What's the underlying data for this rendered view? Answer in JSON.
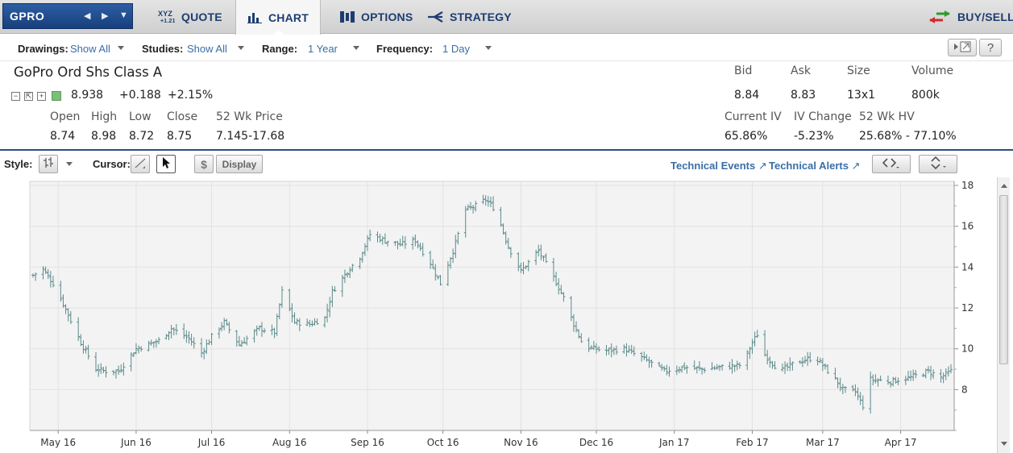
{
  "nav": {
    "symbol": "GPRO",
    "tabs": [
      {
        "label": "QUOTE",
        "icon": "xyz-quote-icon"
      },
      {
        "label": "CHART",
        "icon": "bar-chart-icon"
      },
      {
        "label": "OPTIONS",
        "icon": "options-icon"
      },
      {
        "label": "STRATEGY",
        "icon": "strategy-icon"
      }
    ],
    "buy_sell": "BUY/SELL"
  },
  "drawbar": {
    "drawings_label": "Drawings:",
    "drawings_value": "Show All",
    "studies_label": "Studies:",
    "studies_value": "Show All",
    "range_label": "Range:",
    "range_value": "1 Year",
    "frequency_label": "Frequency:",
    "frequency_value": "1 Day",
    "help_label": "?"
  },
  "quote": {
    "name": "GoPro Ord Shs Class A",
    "last": "8.938",
    "change": "+0.188",
    "change_pct": "+2.15%",
    "open_label": "Open",
    "open": "8.74",
    "high_label": "High",
    "high": "8.98",
    "low_label": "Low",
    "low": "8.72",
    "close_label": "Close",
    "close": "8.75",
    "wk52_label": "52 Wk Price",
    "wk52": "7.145-17.68",
    "bid_label": "Bid",
    "bid": "8.84",
    "ask_label": "Ask",
    "ask": "8.83",
    "size_label": "Size",
    "size": "13x1",
    "volume_label": "Volume",
    "volume": "800k",
    "iv_label": "Current IV",
    "iv": "65.86%",
    "ivchg_label": "IV Change",
    "ivchg": "-5.23%",
    "hv_label": "52 Wk HV",
    "hv": "25.68% - 77.10%",
    "positive_color": "#7bbf7b"
  },
  "stylebar": {
    "style_label": "Style:",
    "cursor_label": "Cursor:",
    "dollar_label": "$",
    "display_label": "Display",
    "tech_events": "Technical Events",
    "tech_alerts": "Technical Alerts"
  },
  "chart_data": {
    "type": "ohlc",
    "color": "#5b8a8a",
    "ylim": [
      6,
      18.2
    ],
    "yticks": [
      8,
      10,
      12,
      14,
      16,
      18
    ],
    "xtick_labels": [
      "May 16",
      "Jun 16",
      "Jul 16",
      "Aug 16",
      "Sep 16",
      "Oct 16",
      "Nov 16",
      "Dec 16",
      "Jan 17",
      "Feb 17",
      "Mar 17",
      "Apr 17"
    ],
    "x_start": "2016-04-21",
    "x_end": "2017-04-21",
    "anchors": [
      [
        "2016-04-21",
        13.6
      ],
      [
        "2016-04-25",
        13.9
      ],
      [
        "2016-04-29",
        13.2
      ],
      [
        "2016-05-03",
        12.2
      ],
      [
        "2016-05-10",
        10.3
      ],
      [
        "2016-05-16",
        9.0
      ],
      [
        "2016-05-20",
        8.9
      ],
      [
        "2016-05-25",
        8.9
      ],
      [
        "2016-06-01",
        10.0
      ],
      [
        "2016-06-10",
        10.4
      ],
      [
        "2016-06-15",
        11.0
      ],
      [
        "2016-06-22",
        10.5
      ],
      [
        "2016-06-27",
        9.8
      ],
      [
        "2016-07-01",
        10.6
      ],
      [
        "2016-07-06",
        11.3
      ],
      [
        "2016-07-12",
        10.2
      ],
      [
        "2016-07-20",
        11.0
      ],
      [
        "2016-07-26",
        10.8
      ],
      [
        "2016-07-29",
        12.8
      ],
      [
        "2016-08-03",
        11.3
      ],
      [
        "2016-08-09",
        11.2
      ],
      [
        "2016-08-15",
        11.5
      ],
      [
        "2016-08-18",
        12.8
      ],
      [
        "2016-08-24",
        13.8
      ],
      [
        "2016-08-29",
        14.5
      ],
      [
        "2016-09-02",
        15.6
      ],
      [
        "2016-09-08",
        15.3
      ],
      [
        "2016-09-14",
        15.1
      ],
      [
        "2016-09-20",
        15.3
      ],
      [
        "2016-09-26",
        14.2
      ],
      [
        "2016-09-30",
        13.2
      ],
      [
        "2016-10-05",
        14.8
      ],
      [
        "2016-10-10",
        16.8
      ],
      [
        "2016-10-14",
        17.0
      ],
      [
        "2016-10-18",
        17.3
      ],
      [
        "2016-10-22",
        16.8
      ],
      [
        "2016-10-27",
        15.0
      ],
      [
        "2016-11-01",
        13.8
      ],
      [
        "2016-11-08",
        14.8
      ],
      [
        "2016-11-14",
        13.5
      ],
      [
        "2016-11-18",
        12.5
      ],
      [
        "2016-11-22",
        11.2
      ],
      [
        "2016-11-26",
        10.1
      ],
      [
        "2016-12-05",
        9.9
      ],
      [
        "2016-12-12",
        10.0
      ],
      [
        "2016-12-20",
        9.5
      ],
      [
        "2016-12-28",
        8.9
      ],
      [
        "2017-01-05",
        9.1
      ],
      [
        "2017-01-12",
        9.0
      ],
      [
        "2017-01-20",
        9.1
      ],
      [
        "2017-01-28",
        9.2
      ],
      [
        "2017-02-01",
        10.3
      ],
      [
        "2017-02-04",
        10.9
      ],
      [
        "2017-02-06",
        9.7
      ],
      [
        "2017-02-12",
        8.9
      ],
      [
        "2017-02-18",
        9.3
      ],
      [
        "2017-02-26",
        9.6
      ],
      [
        "2017-03-06",
        8.5
      ],
      [
        "2017-03-09",
        8.0
      ],
      [
        "2017-03-14",
        7.9
      ],
      [
        "2017-03-17",
        7.2
      ],
      [
        "2017-03-20",
        8.5
      ],
      [
        "2017-03-28",
        8.4
      ],
      [
        "2017-04-05",
        8.6
      ],
      [
        "2017-04-12",
        8.9
      ],
      [
        "2017-04-17",
        8.6
      ],
      [
        "2017-04-21",
        8.9
      ]
    ]
  }
}
